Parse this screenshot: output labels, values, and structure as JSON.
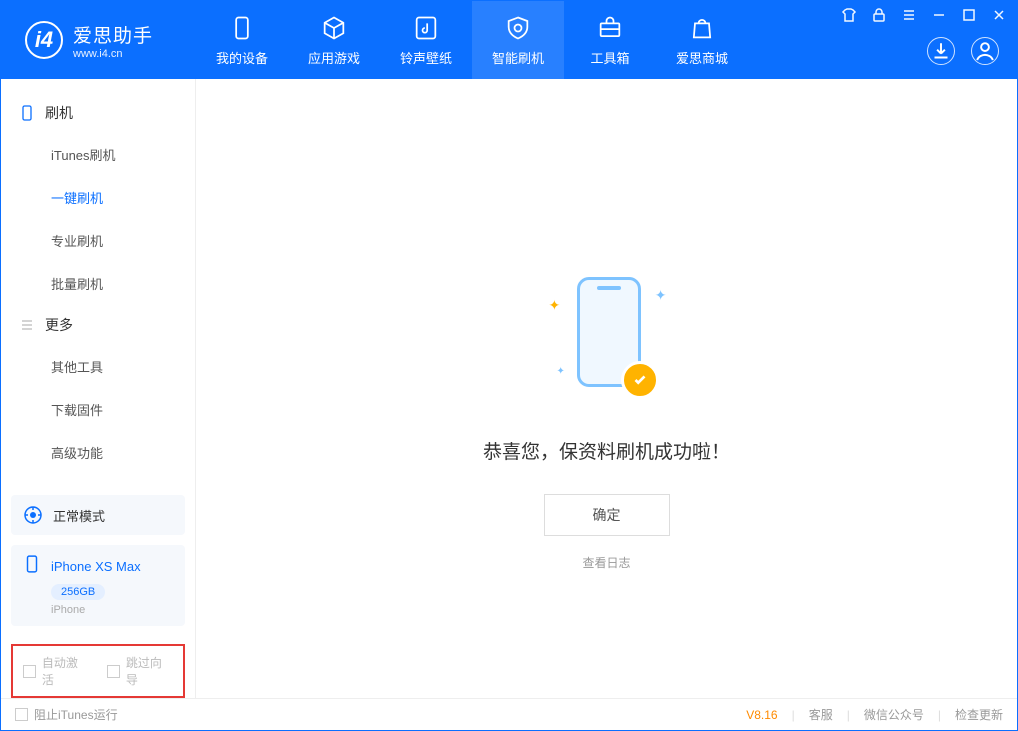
{
  "app": {
    "name": "爱思助手",
    "url": "www.i4.cn"
  },
  "header": {
    "tabs": [
      {
        "label": "我的设备"
      },
      {
        "label": "应用游戏"
      },
      {
        "label": "铃声壁纸"
      },
      {
        "label": "智能刷机"
      },
      {
        "label": "工具箱"
      },
      {
        "label": "爱思商城"
      }
    ]
  },
  "sidebar": {
    "group1": {
      "title": "刷机",
      "items": [
        "iTunes刷机",
        "一键刷机",
        "专业刷机",
        "批量刷机"
      ]
    },
    "group2": {
      "title": "更多",
      "items": [
        "其他工具",
        "下载固件",
        "高级功能"
      ]
    },
    "mode": "正常模式",
    "device": {
      "name": "iPhone XS Max",
      "storage": "256GB",
      "type": "iPhone"
    },
    "checkboxes": {
      "auto_activate": "自动激活",
      "skip_guide": "跳过向导"
    }
  },
  "main": {
    "success_text": "恭喜您，保资料刷机成功啦！",
    "ok_button": "确定",
    "log_link": "查看日志"
  },
  "footer": {
    "block_itunes": "阻止iTunes运行",
    "version": "V8.16",
    "links": [
      "客服",
      "微信公众号",
      "检查更新"
    ]
  }
}
